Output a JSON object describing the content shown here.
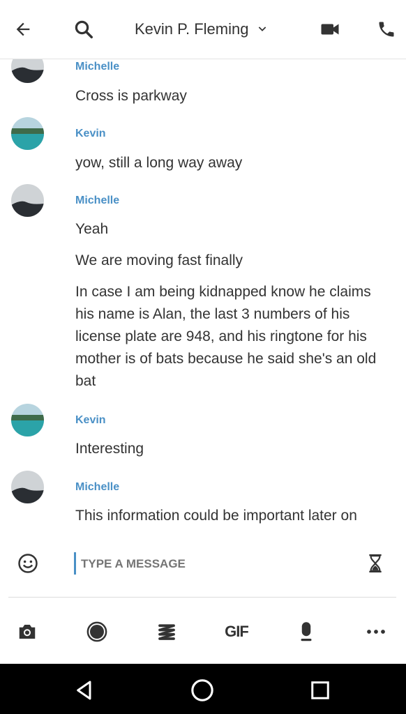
{
  "header": {
    "contact_name": "Kevin P. Fleming",
    "icons": [
      "back-arrow-icon",
      "search-icon",
      "chevron-down-icon",
      "video-call-icon",
      "phone-call-icon"
    ]
  },
  "messages": [
    {
      "sender": "Michelle",
      "lines": [
        "Cross is parkway"
      ]
    },
    {
      "sender": "Kevin",
      "lines": [
        "yow, still a long way away"
      ]
    },
    {
      "sender": "Michelle",
      "lines": [
        "Yeah",
        "We are moving fast finally",
        "In case I am being kidnapped know he claims his name is Alan, the last 3 numbers of his license plate are 948, and his ringtone for his mother is of bats because he said she's an old bat"
      ]
    },
    {
      "sender": "Kevin",
      "lines": [
        "Interesting"
      ]
    },
    {
      "sender": "Michelle",
      "lines": [
        "This information could be important later on"
      ]
    }
  ],
  "composer": {
    "placeholder": "TYPE A MESSAGE",
    "icons": [
      "emoji-icon",
      "hourglass-icon"
    ]
  },
  "toolbar": {
    "gif_label": "GIF",
    "icons": [
      "camera-icon",
      "record-icon",
      "sticker-icon",
      "gif-icon",
      "microphone-icon",
      "more-icon"
    ]
  },
  "navbar": {
    "icons": [
      "back-triangle-icon",
      "home-circle-icon",
      "recents-square-icon"
    ]
  },
  "colors": {
    "accent": "#4a90c6",
    "text": "#333333",
    "navbar": "#000000"
  }
}
